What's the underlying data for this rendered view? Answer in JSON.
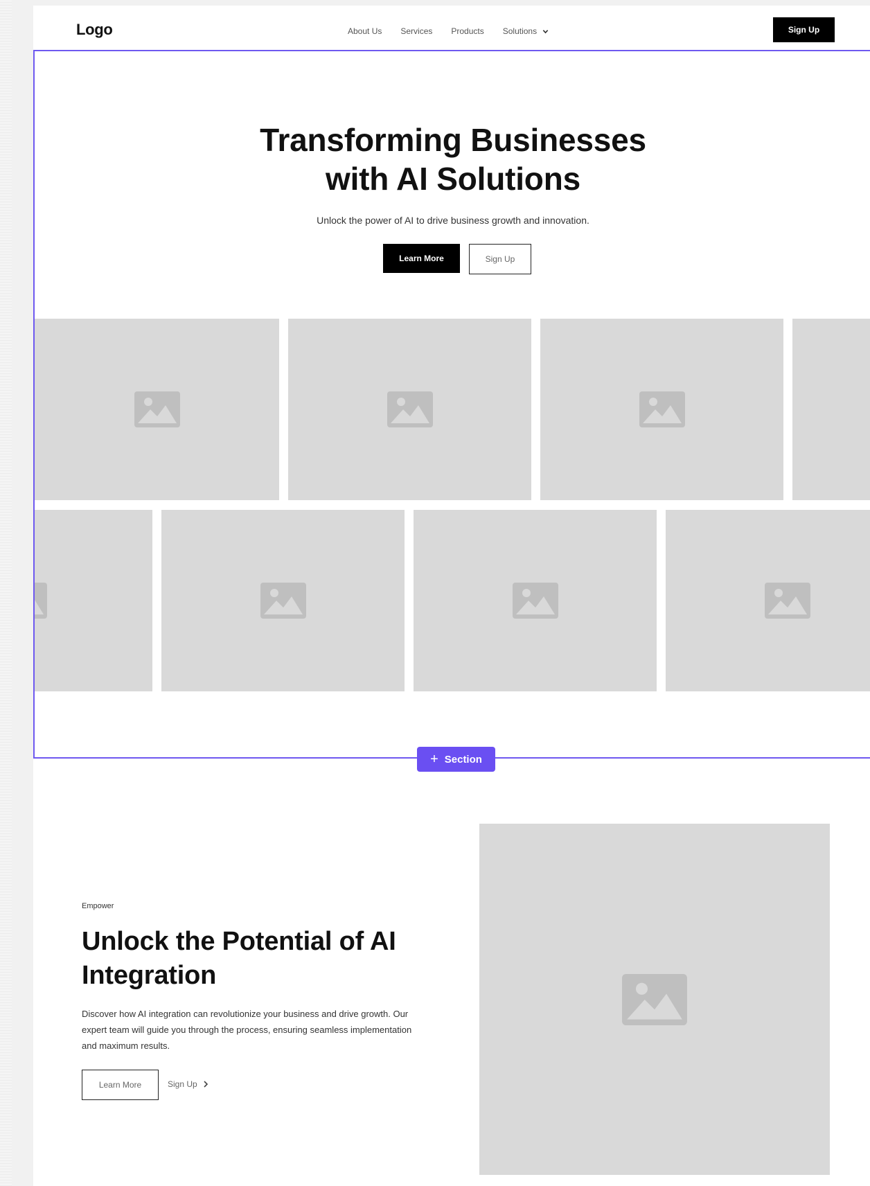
{
  "nav": {
    "logo": "Logo",
    "links": [
      "About Us",
      "Services",
      "Products"
    ],
    "dropdown_label": "Solutions",
    "signup_label": "Sign Up"
  },
  "hero": {
    "title_line1": "Transforming Businesses",
    "title_line2": "with AI Solutions",
    "subtitle": "Unlock the power of AI to drive business growth and innovation.",
    "primary_button": "Learn More",
    "secondary_button": "Sign Up"
  },
  "builder": {
    "add_section_label": "Section"
  },
  "feature": {
    "eyebrow": "Empower",
    "title": "Unlock the Potential of AI Integration",
    "body": "Discover how AI integration can revolutionize your business and drive growth. Our expert team will guide you through the process, ensuring seamless implementation and maximum results.",
    "primary_button": "Learn More",
    "link_button": "Sign Up"
  },
  "colors": {
    "accent": "#6a4ff2",
    "placeholder": "#d9d9d9",
    "dark_button": "#000000"
  }
}
